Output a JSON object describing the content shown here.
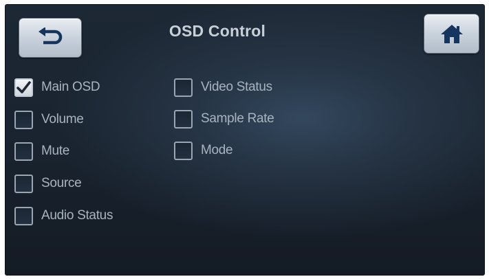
{
  "screen": {
    "title": "OSD Control"
  },
  "nav": {
    "back_icon": "back-arrow-icon",
    "home_icon": "home-icon"
  },
  "colors": {
    "background_dark": "#161e28",
    "background_light": "#33475d",
    "text": "#aab4bf",
    "title": "#c8d0d8",
    "button_face": "#c9d2dc",
    "icon": "#16355e"
  },
  "options": {
    "main_osd": {
      "label": "Main OSD",
      "checked": true
    },
    "volume": {
      "label": "Volume",
      "checked": false
    },
    "mute": {
      "label": "Mute",
      "checked": false
    },
    "source": {
      "label": "Source",
      "checked": false
    },
    "audio_status": {
      "label": "Audio Status",
      "checked": false
    },
    "video_status": {
      "label": "Video Status",
      "checked": false
    },
    "sample_rate": {
      "label": "Sample Rate",
      "checked": false
    },
    "mode": {
      "label": "Mode",
      "checked": false
    }
  }
}
